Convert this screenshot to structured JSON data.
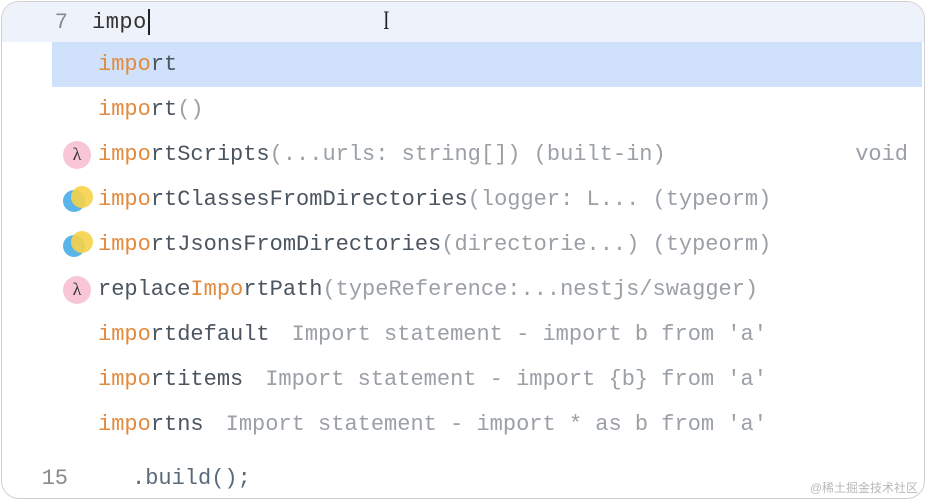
{
  "editor": {
    "line_number": "7",
    "typed": "impo",
    "bottom_line_number": "15",
    "bottom_code": ".build();"
  },
  "suggestions": [
    {
      "icon": null,
      "match": "impo",
      "rest": "rt",
      "sig": "",
      "right": "",
      "desc": ""
    },
    {
      "icon": null,
      "match": "impo",
      "rest": "rt",
      "sig": "()",
      "right": "",
      "desc": ""
    },
    {
      "icon": "lambda",
      "match": "impo",
      "rest": "rtScripts",
      "sig": "(...urls: string[]) (built-in)",
      "right": "void",
      "desc": ""
    },
    {
      "icon": "stack",
      "match": "impo",
      "rest": "rtClassesFromDirectories",
      "sig": "(logger: L... (typeorm)",
      "right": "",
      "desc": ""
    },
    {
      "icon": "stack",
      "match": "impo",
      "rest": "rtJsonsFromDirectories",
      "sig": "(directorie...) (typeorm)",
      "right": "",
      "desc": ""
    },
    {
      "icon": "lambda",
      "pre": "replace",
      "match": "Impo",
      "rest": "rtPath",
      "sig": "(typeReference:...nestjs/swagger)",
      "right": "",
      "desc": ""
    },
    {
      "icon": null,
      "match": "impo",
      "rest": "rtdefault",
      "sig": "",
      "right": "",
      "desc": "Import statement - import b from 'a'"
    },
    {
      "icon": null,
      "match": "impo",
      "rest": "rtitems",
      "sig": "",
      "right": "",
      "desc": "Import statement - import {b} from 'a'"
    },
    {
      "icon": null,
      "match": "impo",
      "rest": "rtns",
      "sig": "",
      "right": "",
      "desc": "Import statement - import * as b from 'a'"
    }
  ],
  "watermark": "@稀土掘金技术社区"
}
